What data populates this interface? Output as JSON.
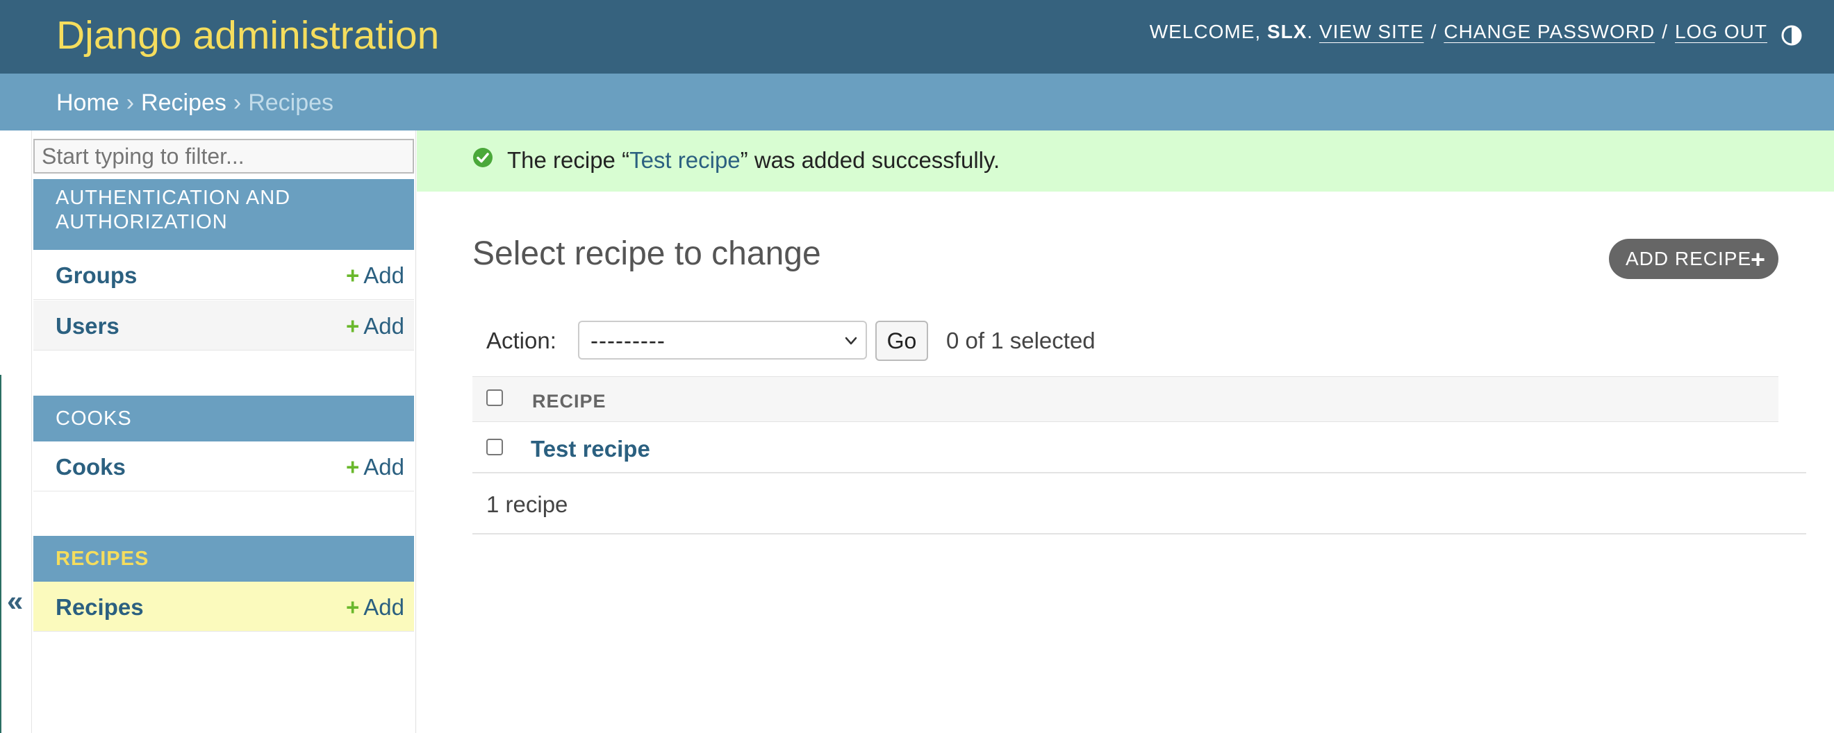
{
  "header": {
    "branding": "Django administration",
    "welcome_prefix": "WELCOME,",
    "username": "SLX",
    "view_site": "VIEW SITE",
    "change_password": "CHANGE PASSWORD",
    "log_out": "LOG OUT",
    "separator": "/",
    "period": "."
  },
  "breadcrumbs": {
    "items": [
      "Home",
      "Recipes",
      "Recipes"
    ],
    "arrow": "›"
  },
  "sidebar": {
    "filter_placeholder": "Start typing to filter...",
    "toggle_symbol": "«",
    "add_label": "Add",
    "add_symbol": "+",
    "modules": [
      {
        "caption": "AUTHENTICATION AND AUTHORIZATION",
        "caption_line1": "AUTHENTICATION AND",
        "caption_line2": "AUTHORIZATION",
        "models": [
          "Groups",
          "Users"
        ]
      },
      {
        "caption": "COOKS",
        "models": [
          "Cooks"
        ]
      },
      {
        "caption": "RECIPES",
        "models": [
          "Recipes"
        ],
        "current": true
      }
    ]
  },
  "messages": {
    "prefix": "The recipe “",
    "object_link": "Test recipe",
    "suffix": "” was added successfully."
  },
  "content": {
    "title": "Select recipe to change",
    "add_button": "ADD RECIPE",
    "add_button_symbol": "+",
    "action_label": "Action:",
    "action_value": "---------",
    "go_label": "Go",
    "action_counter": "0 of 1 selected",
    "column_header": "RECIPE",
    "rows": [
      "Test recipe"
    ],
    "paginator": "1 recipe"
  },
  "colors": {
    "header_bg": "#36627e",
    "branding": "#f5dd5d",
    "breadcrumbs_bg": "#6a9fc0",
    "success_bg": "#d8fdd2",
    "link": "#2b6080",
    "add_plus": "#6ab82c",
    "current_row_bg": "#fbfabd"
  },
  "icons": {
    "theme_toggle": "half-circle-icon",
    "success": "check-circle-icon",
    "select_chevron": "chevron-down-icon",
    "nav_toggle": "double-chevron-left-icon"
  }
}
